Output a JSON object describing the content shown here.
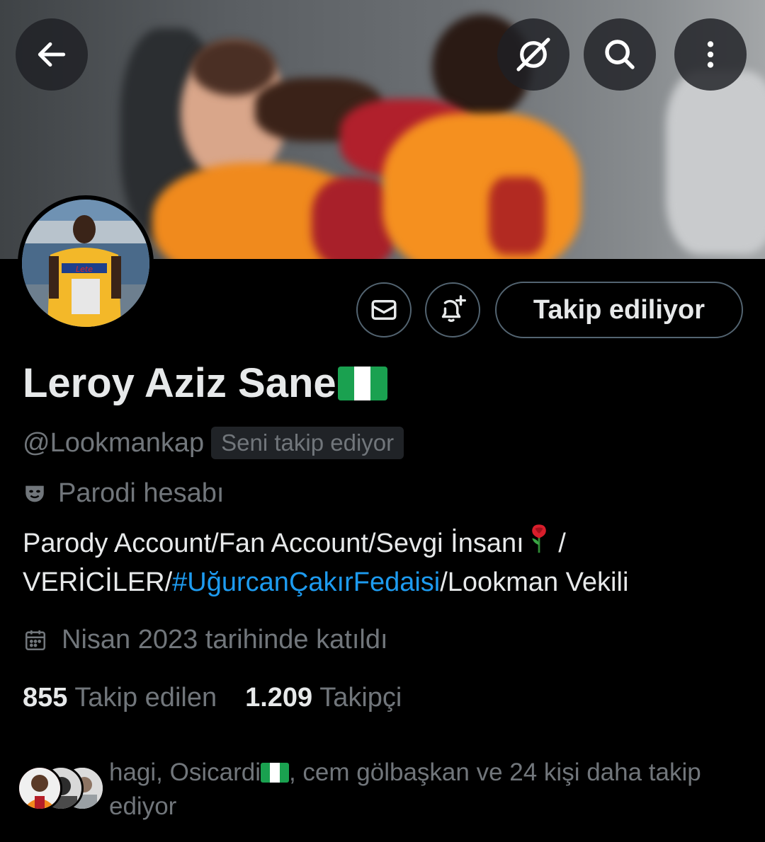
{
  "header": {
    "back_icon": "arrow-left-icon",
    "grok_icon": "grok-icon",
    "search_icon": "search-icon",
    "more_icon": "more-vertical-icon"
  },
  "actions": {
    "message_icon": "envelope-icon",
    "notify_icon": "bell-plus-icon",
    "follow_label": "Takip ediliyor"
  },
  "profile": {
    "name": "Leroy Aziz Sane",
    "handle": "@Lookmankap",
    "follows_you_badge": "Seni takip ediyor",
    "parody_label": "Parodi hesabı",
    "bio_part1": "Parody Account/Fan Account/Sevgi İnsanı",
    "bio_part2": " /",
    "bio_part3": "VERİCİLER/",
    "bio_hashtag": "#UğurcanÇakırFedaisi",
    "bio_part4": "/Lookman Vekili",
    "joined": "Nisan 2023 tarihinde katıldı"
  },
  "stats": {
    "following_count": "855",
    "following_label": "Takip edilen",
    "followers_count": "1.209",
    "followers_label": "Takipçi"
  },
  "followed_by": {
    "text_part1": "hagi, Osicardi",
    "text_part2": ", cem gölbaşkan ve 24 kişi daha takip ediyor"
  },
  "colors": {
    "background": "#000000",
    "text_primary": "#e7e9ea",
    "text_secondary": "#71767b",
    "link": "#1d9bf0",
    "border": "#536471",
    "badge_bg": "#202327"
  }
}
